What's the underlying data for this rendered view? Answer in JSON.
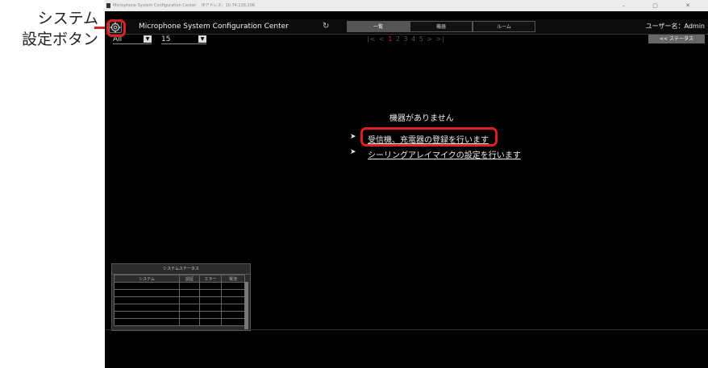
{
  "callout": {
    "line1": "システム",
    "line2": "設定ボタン"
  },
  "window": {
    "title": "Microphone System Configuration Center",
    "ip": "IPアドレス：10.74.228.206",
    "controls": "–  ▢  ✕"
  },
  "header": {
    "app_title": "Microphone System Configuration Center",
    "refresh_icon": "↻",
    "tabs": [
      {
        "label": "一覧"
      },
      {
        "label": "機器"
      },
      {
        "label": "ルーム"
      }
    ],
    "user": "ユーザー名：Admin"
  },
  "toolbar": {
    "filter_value": "All",
    "page_size_value": "15",
    "pager": {
      "first": "|<",
      "prev": "<",
      "pages": [
        "1",
        "2",
        "3",
        "4",
        "5"
      ],
      "current": "1",
      "next": ">",
      "last": ">|"
    },
    "status_button": "<< ステータス"
  },
  "main": {
    "empty_message": "機器がありません",
    "links": [
      {
        "label": "受信機、充電器の登録を行います"
      },
      {
        "label": "シーリングアレイマイクの設定を行います"
      }
    ]
  },
  "status_panel": {
    "title": "システムステータス",
    "columns": [
      "システム",
      "認証",
      "エラー",
      "電池"
    ],
    "rows": 6
  },
  "colors": {
    "accent_red": "#e02020",
    "background": "#000000"
  }
}
